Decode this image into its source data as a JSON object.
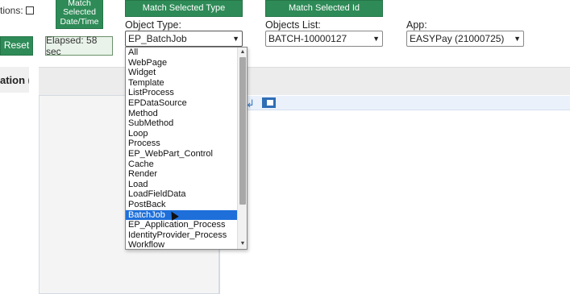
{
  "header": {
    "options_label": "tions:",
    "match_date_button": [
      "Match",
      "Selected",
      "Date/Time"
    ],
    "match_type_button": "Match Selected Type",
    "match_id_button": "Match Selected Id",
    "reset_button": "Reset",
    "elapsed_text": "Elapsed: 58 sec"
  },
  "fields": {
    "object_type_label": "Object Type:",
    "object_type_value": "EP_BatchJob",
    "objects_list_label": "Objects List:",
    "objects_list_value": "BATCH-10000127",
    "app_label": "App:",
    "app_value": "EASYPay (21000725)"
  },
  "left_column_header": "ation (n",
  "dropdown": {
    "items": [
      "All",
      "WebPage",
      "Widget",
      "Template",
      "ListProcess",
      "EPDataSource",
      "Method",
      "SubMethod",
      "Loop",
      "Process",
      "EP_WebPart_Control",
      "Cache",
      "Render",
      "Load",
      "LoadFieldData",
      "PostBack",
      "BatchJob",
      "EP_Application_Process",
      "IdentityProvider_Process",
      "Workflow"
    ],
    "highlighted": "BatchJob"
  },
  "colors": {
    "button_green": "#2e8b57",
    "highlight_blue": "#1e6fd9"
  },
  "icons": [
    "chevron-down-icon",
    "wrap-text-icon",
    "panel-icon",
    "mouse-cursor-icon"
  ]
}
